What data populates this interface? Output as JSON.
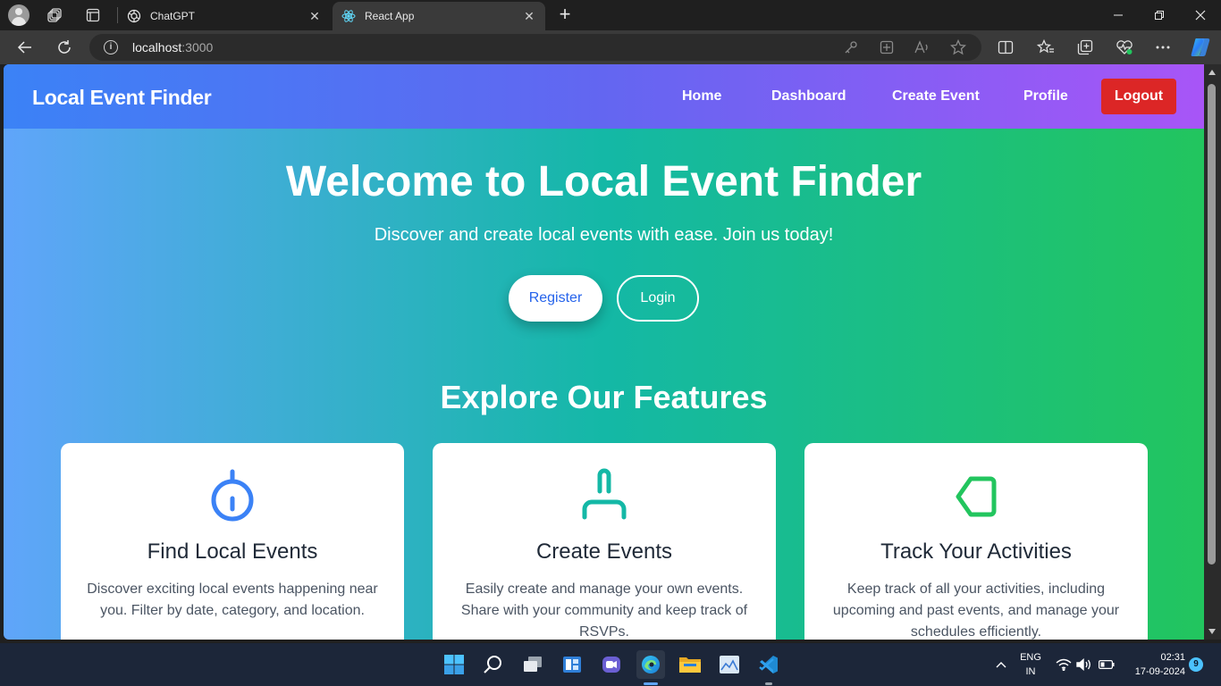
{
  "browser": {
    "tabs": [
      {
        "title": "ChatGPT",
        "active": false,
        "favicon": "chatgpt-icon"
      },
      {
        "title": "React App",
        "active": true,
        "favicon": "react-icon"
      }
    ],
    "address": {
      "host": "localhost",
      "port": ":3000"
    }
  },
  "app": {
    "brand": "Local Event Finder",
    "nav": [
      "Home",
      "Dashboard",
      "Create Event",
      "Profile"
    ],
    "logout_label": "Logout",
    "hero": {
      "title": "Welcome to Local Event Finder",
      "subtitle": "Discover and create local events with ease. Join us today!",
      "register_label": "Register",
      "login_label": "Login"
    },
    "features_title": "Explore Our Features",
    "features": [
      {
        "icon": "clock-icon",
        "title": "Find Local Events",
        "desc": "Discover exciting local events happening near you. Filter by date, category, and location."
      },
      {
        "icon": "person-icon",
        "title": "Create Events",
        "desc": "Easily create and manage your own events. Share with your community and keep track of RSVPs."
      },
      {
        "icon": "tag-icon",
        "title": "Track Your Activities",
        "desc": "Keep track of all your activities, including upcoming and past events, and manage your schedules efficiently."
      }
    ],
    "colors": {
      "nav_start": "#3b82f6",
      "nav_end": "#a855f7",
      "bg_start": "#60a5fa",
      "bg_mid": "#14b8a6",
      "bg_end": "#22c55e",
      "logout": "#dc2626"
    }
  },
  "taskbar": {
    "language": "ENG",
    "region": "IN",
    "time": "02:31",
    "date": "17-09-2024",
    "notifications": "9"
  }
}
